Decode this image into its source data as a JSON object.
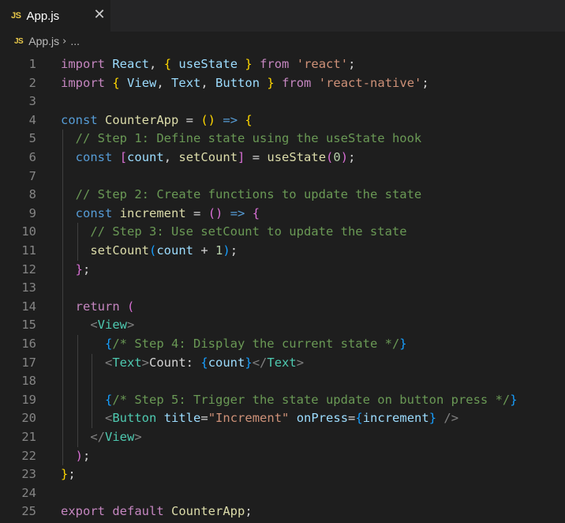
{
  "tab": {
    "icon": "JS",
    "filename": "App.js",
    "close_symbol": "✕"
  },
  "breadcrumb": {
    "icon": "JS",
    "file": "App.js",
    "separator": "›",
    "rest": "..."
  },
  "editor": {
    "line_numbers": [
      "1",
      "2",
      "3",
      "4",
      "5",
      "6",
      "7",
      "8",
      "9",
      "10",
      "11",
      "12",
      "13",
      "14",
      "15",
      "16",
      "17",
      "18",
      "19",
      "20",
      "21",
      "22",
      "23",
      "24",
      "25"
    ],
    "lines": [
      [
        [
          "kw2",
          "import"
        ],
        [
          "op",
          " "
        ],
        [
          "var",
          "React"
        ],
        [
          "op",
          ", "
        ],
        [
          "br1",
          "{"
        ],
        [
          "op",
          " "
        ],
        [
          "var",
          "useState"
        ],
        [
          "op",
          " "
        ],
        [
          "br1",
          "}"
        ],
        [
          "op",
          " "
        ],
        [
          "kw2",
          "from"
        ],
        [
          "op",
          " "
        ],
        [
          "str",
          "'react'"
        ],
        [
          "op",
          ";"
        ]
      ],
      [
        [
          "kw2",
          "import"
        ],
        [
          "op",
          " "
        ],
        [
          "br1",
          "{"
        ],
        [
          "op",
          " "
        ],
        [
          "var",
          "View"
        ],
        [
          "op",
          ", "
        ],
        [
          "var",
          "Text"
        ],
        [
          "op",
          ", "
        ],
        [
          "var",
          "Button"
        ],
        [
          "op",
          " "
        ],
        [
          "br1",
          "}"
        ],
        [
          "op",
          " "
        ],
        [
          "kw2",
          "from"
        ],
        [
          "op",
          " "
        ],
        [
          "str",
          "'react-native'"
        ],
        [
          "op",
          ";"
        ]
      ],
      [],
      [
        [
          "kw",
          "const"
        ],
        [
          "op",
          " "
        ],
        [
          "fn",
          "CounterApp"
        ],
        [
          "op",
          " = "
        ],
        [
          "br1",
          "()"
        ],
        [
          "op",
          " "
        ],
        [
          "kw",
          "=>"
        ],
        [
          "op",
          " "
        ],
        [
          "br1",
          "{"
        ]
      ],
      [
        [
          "op",
          "  "
        ],
        [
          "cmt",
          "// Step 1: Define state using the useState hook"
        ]
      ],
      [
        [
          "op",
          "  "
        ],
        [
          "kw",
          "const"
        ],
        [
          "op",
          " "
        ],
        [
          "br2",
          "["
        ],
        [
          "var",
          "count"
        ],
        [
          "op",
          ", "
        ],
        [
          "fn",
          "setCount"
        ],
        [
          "br2",
          "]"
        ],
        [
          "op",
          " = "
        ],
        [
          "fn",
          "useState"
        ],
        [
          "br2",
          "("
        ],
        [
          "num",
          "0"
        ],
        [
          "br2",
          ")"
        ],
        [
          "op",
          ";"
        ]
      ],
      [],
      [
        [
          "op",
          "  "
        ],
        [
          "cmt",
          "// Step 2: Create functions to update the state"
        ]
      ],
      [
        [
          "op",
          "  "
        ],
        [
          "kw",
          "const"
        ],
        [
          "op",
          " "
        ],
        [
          "fn",
          "increment"
        ],
        [
          "op",
          " = "
        ],
        [
          "br2",
          "()"
        ],
        [
          "op",
          " "
        ],
        [
          "kw",
          "=>"
        ],
        [
          "op",
          " "
        ],
        [
          "br2",
          "{"
        ]
      ],
      [
        [
          "op",
          "    "
        ],
        [
          "cmt",
          "// Step 3: Use setCount to update the state"
        ]
      ],
      [
        [
          "op",
          "    "
        ],
        [
          "fn",
          "setCount"
        ],
        [
          "br3",
          "("
        ],
        [
          "var",
          "count"
        ],
        [
          "op",
          " + "
        ],
        [
          "num",
          "1"
        ],
        [
          "br3",
          ")"
        ],
        [
          "op",
          ";"
        ]
      ],
      [
        [
          "op",
          "  "
        ],
        [
          "br2",
          "}"
        ],
        [
          "op",
          ";"
        ]
      ],
      [],
      [
        [
          "op",
          "  "
        ],
        [
          "kw2",
          "return"
        ],
        [
          "op",
          " "
        ],
        [
          "br2",
          "("
        ]
      ],
      [
        [
          "op",
          "    "
        ],
        [
          "angle",
          "<"
        ],
        [
          "tag",
          "View"
        ],
        [
          "angle",
          ">"
        ]
      ],
      [
        [
          "op",
          "      "
        ],
        [
          "br3",
          "{"
        ],
        [
          "cmt",
          "/* Step 4: Display the current state */"
        ],
        [
          "br3",
          "}"
        ]
      ],
      [
        [
          "op",
          "      "
        ],
        [
          "angle",
          "<"
        ],
        [
          "tag",
          "Text"
        ],
        [
          "angle",
          ">"
        ],
        [
          "op",
          "Count: "
        ],
        [
          "br3",
          "{"
        ],
        [
          "var",
          "count"
        ],
        [
          "br3",
          "}"
        ],
        [
          "angle",
          "</"
        ],
        [
          "tag",
          "Text"
        ],
        [
          "angle",
          ">"
        ]
      ],
      [],
      [
        [
          "op",
          "      "
        ],
        [
          "br3",
          "{"
        ],
        [
          "cmt",
          "/* Step 5: Trigger the state update on button press */"
        ],
        [
          "br3",
          "}"
        ]
      ],
      [
        [
          "op",
          "      "
        ],
        [
          "angle",
          "<"
        ],
        [
          "tag",
          "Button"
        ],
        [
          "op",
          " "
        ],
        [
          "attr",
          "title"
        ],
        [
          "op",
          "="
        ],
        [
          "str",
          "\"Increment\""
        ],
        [
          "op",
          " "
        ],
        [
          "attr",
          "onPress"
        ],
        [
          "op",
          "="
        ],
        [
          "br3",
          "{"
        ],
        [
          "var",
          "increment"
        ],
        [
          "br3",
          "}"
        ],
        [
          "op",
          " "
        ],
        [
          "angle",
          "/>"
        ]
      ],
      [
        [
          "op",
          "    "
        ],
        [
          "angle",
          "</"
        ],
        [
          "tag",
          "View"
        ],
        [
          "angle",
          ">"
        ]
      ],
      [
        [
          "op",
          "  "
        ],
        [
          "br2",
          ")"
        ],
        [
          "op",
          ";"
        ]
      ],
      [
        [
          "br1",
          "}"
        ],
        [
          "op",
          ";"
        ]
      ],
      [],
      [
        [
          "kw2",
          "export"
        ],
        [
          "op",
          " "
        ],
        [
          "kw2",
          "default"
        ],
        [
          "op",
          " "
        ],
        [
          "fn",
          "CounterApp"
        ],
        [
          "op",
          ";"
        ]
      ]
    ]
  }
}
